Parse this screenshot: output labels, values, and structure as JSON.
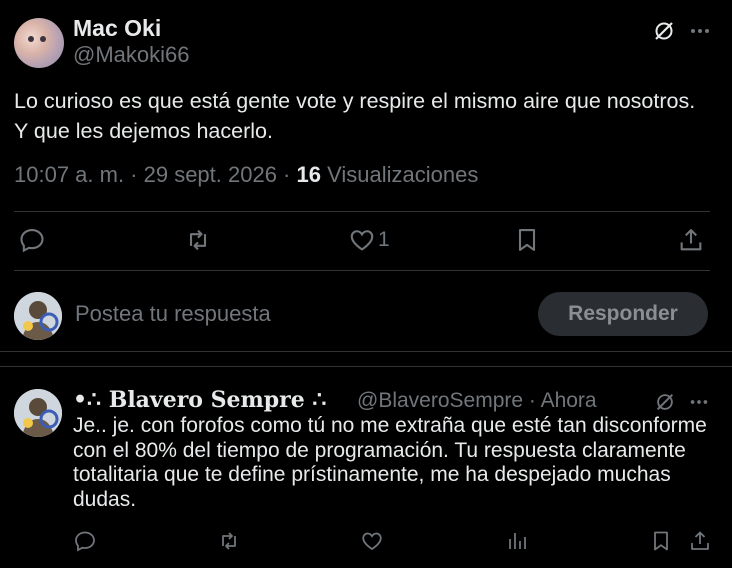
{
  "tweet": {
    "author_name": "Mac Oki",
    "author_handle": "@Makoki66",
    "text": "Lo curioso es que está gente vote y respire el mismo aire que nosotros. Y que les dejemos hacerlo.",
    "time": "10:07 a. m. · 29 sept. 2026 · ",
    "views_count": "16",
    "views_label": " Visualizaciones",
    "likes": "1"
  },
  "composer": {
    "placeholder": "Postea tu respuesta",
    "button_label": "Responder"
  },
  "reply": {
    "author_name": "•∴ Blavero Sempre ∴",
    "author_handle": "@BlaveroSempre",
    "time": " · Ahora",
    "text": "Je.. je. con forofos como tú no me extraña que esté tan disconforme con el 80% del tiempo de programación. Tu respuesta claramente totalitaria que te define prístinamente, me ha despejado muchas dudas."
  },
  "icons": {
    "grok": "grok-icon",
    "more": "more-icon",
    "reply": "reply-icon",
    "retweet": "retweet-icon",
    "like": "heart-icon",
    "bookmark": "bookmark-icon",
    "share": "share-icon",
    "views": "analytics-icon"
  }
}
